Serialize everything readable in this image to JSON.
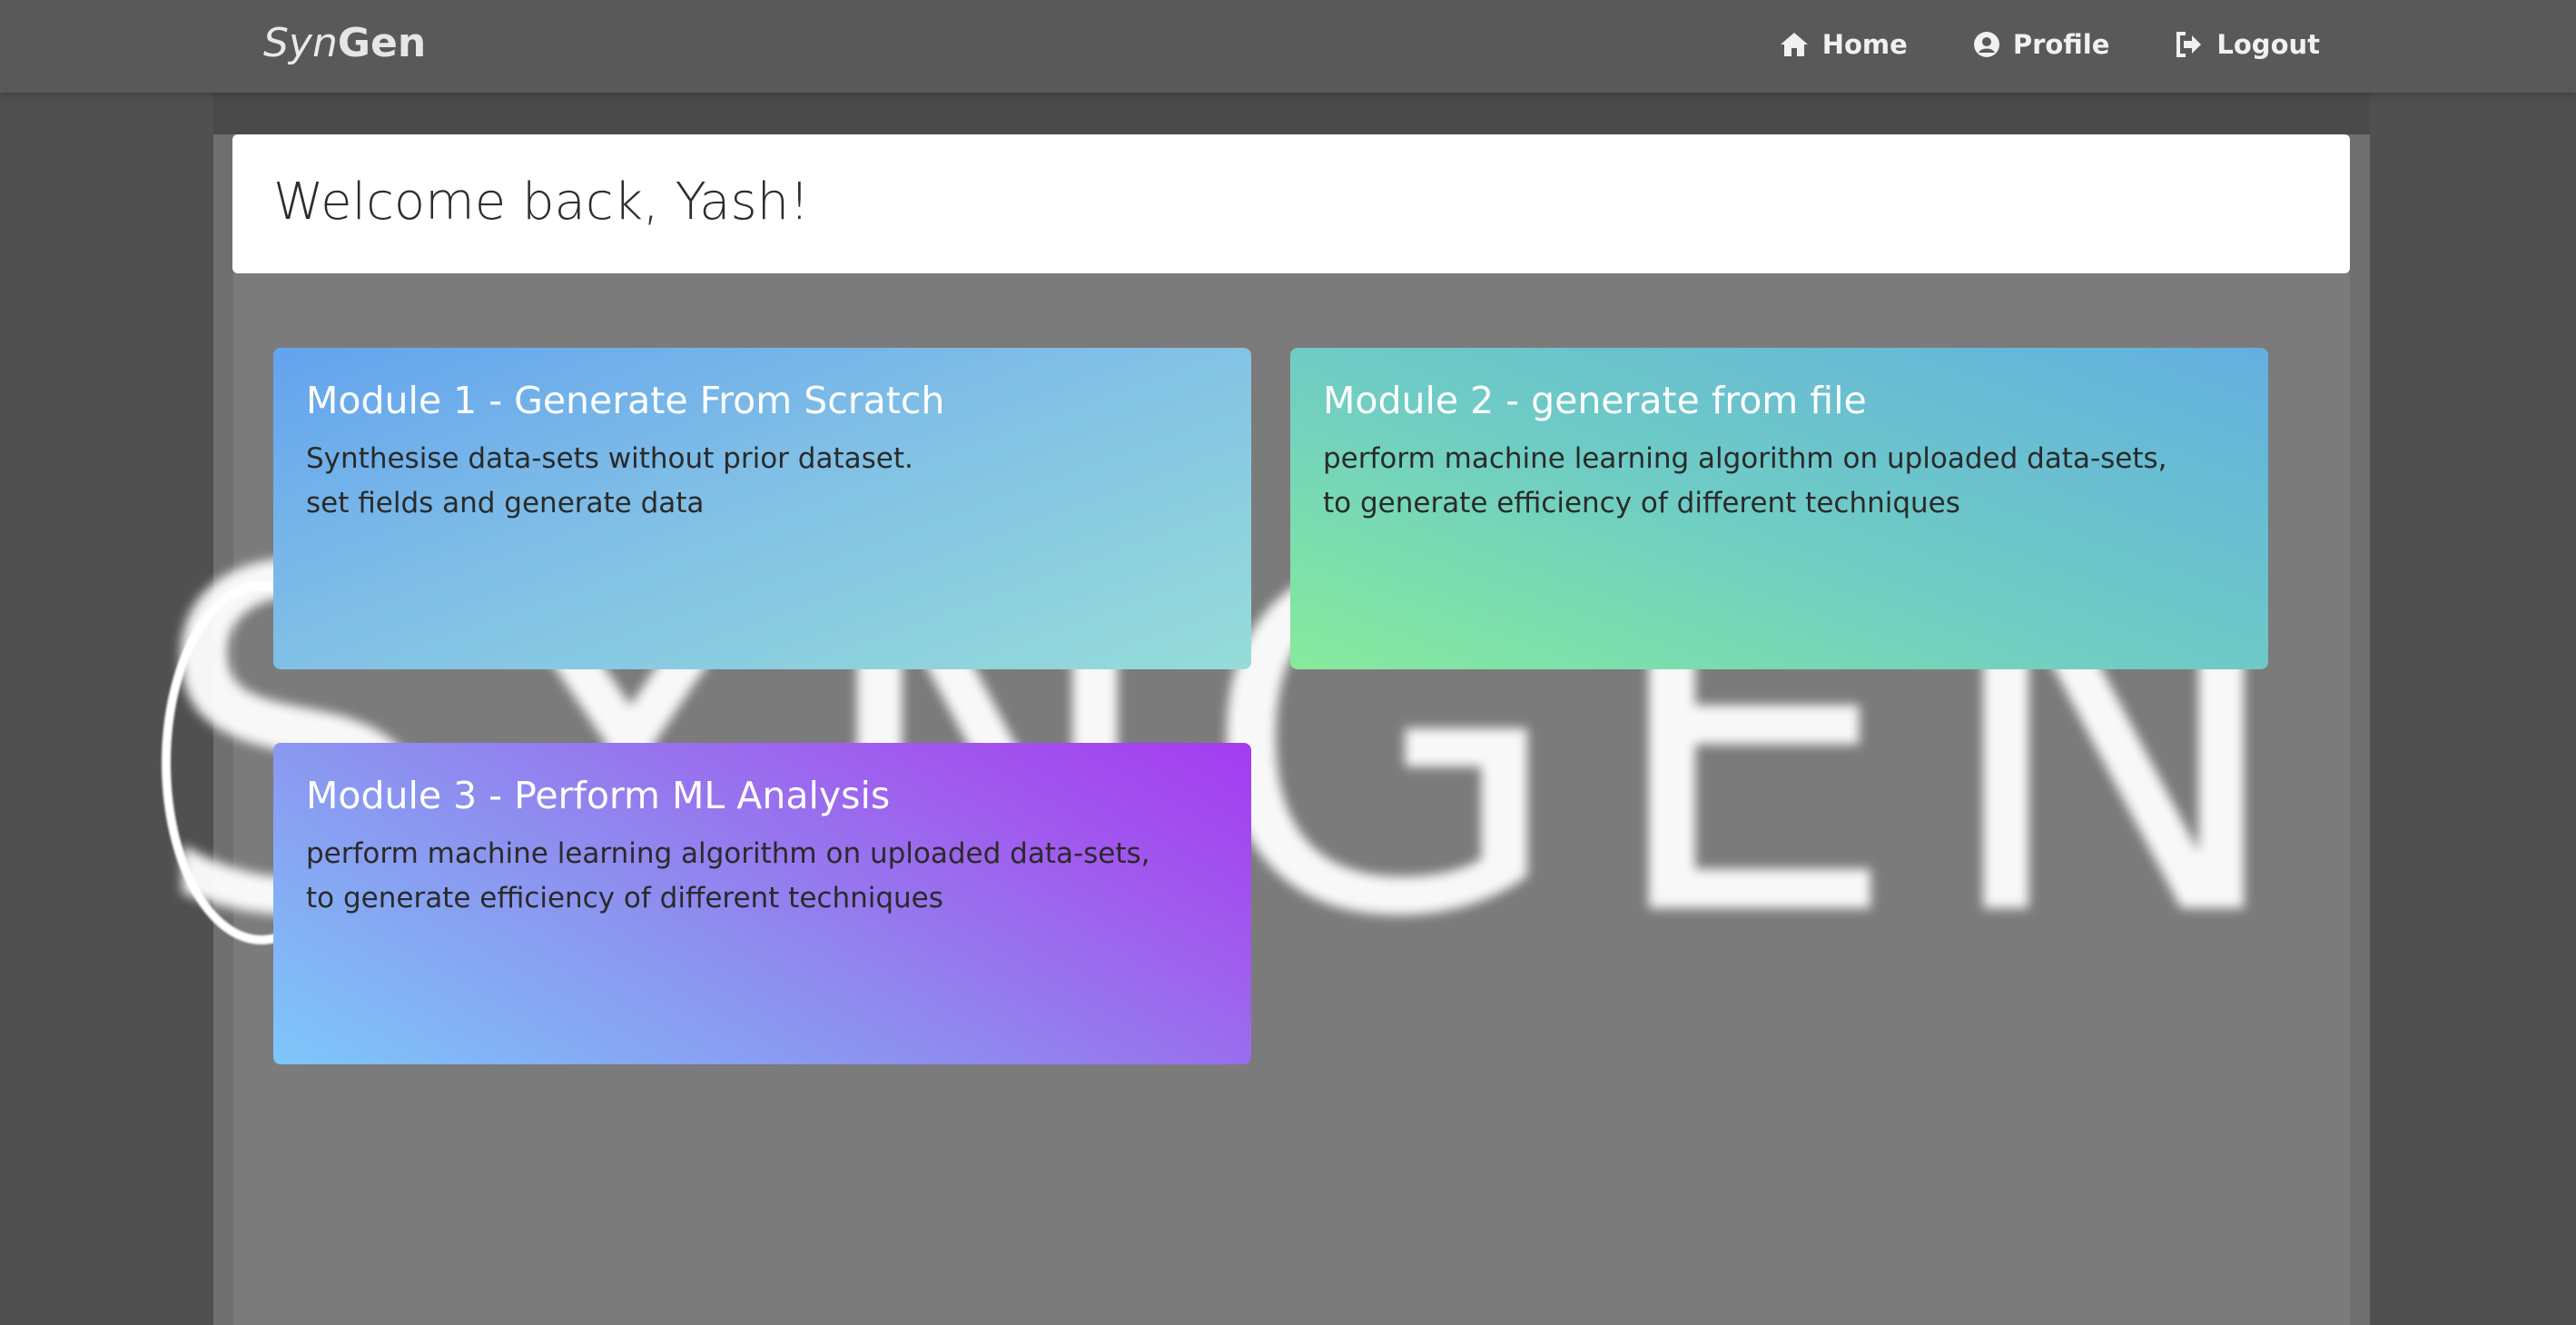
{
  "brand": {
    "light": "Syn",
    "bold": "Gen"
  },
  "nav": [
    {
      "label": "Home",
      "icon": "home-icon"
    },
    {
      "label": "Profile",
      "icon": "user-circle-icon"
    },
    {
      "label": "Logout",
      "icon": "logout-icon"
    }
  ],
  "welcome": {
    "title": "Welcome back, Yash!"
  },
  "watermark": "SYNGEN",
  "modules": [
    {
      "title": "Module 1 - Generate From Scratch",
      "description": "Synthesise data-sets without prior dataset.\nset fields and generate data"
    },
    {
      "title": "Module 2 - generate from file",
      "description": "perform machine learning algorithm on uploaded data-sets,\nto generate efficiency of different techniques"
    },
    {
      "title": "Module 3 - Perform ML Analysis",
      "description": "perform machine learning algorithm on uploaded data-sets,\nto generate efficiency of different techniques"
    }
  ]
}
